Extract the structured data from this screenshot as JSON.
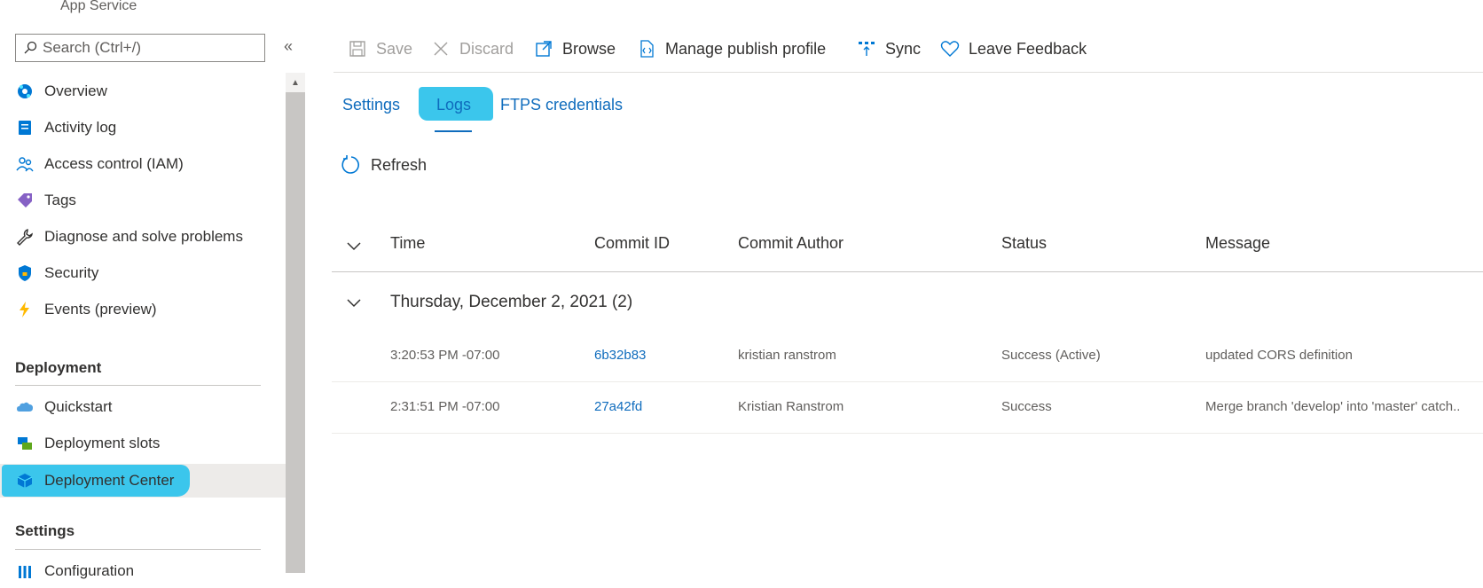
{
  "app": {
    "service_label": "App Service"
  },
  "search": {
    "placeholder": "Search (Ctrl+/)"
  },
  "collapse_icon": "double-chevron-left",
  "sidebar": {
    "items": [
      {
        "label": "Overview",
        "icon": "globe-icon"
      },
      {
        "label": "Activity log",
        "icon": "activity-log-icon"
      },
      {
        "label": "Access control (IAM)",
        "icon": "people-icon"
      },
      {
        "label": "Tags",
        "icon": "tag-icon"
      },
      {
        "label": "Diagnose and solve problems",
        "icon": "wrench-icon"
      },
      {
        "label": "Security",
        "icon": "shield-icon"
      },
      {
        "label": "Events (preview)",
        "icon": "lightning-icon"
      }
    ],
    "deployment_section": "Deployment",
    "deployment_items": [
      {
        "label": "Quickstart",
        "icon": "cloud-icon"
      },
      {
        "label": "Deployment slots",
        "icon": "slots-icon"
      },
      {
        "label": "Deployment Center",
        "icon": "cube-icon"
      }
    ],
    "settings_section": "Settings",
    "settings_items": [
      {
        "label": "Configuration",
        "icon": "bars-icon"
      }
    ]
  },
  "toolbar": {
    "save": "Save",
    "discard": "Discard",
    "browse": "Browse",
    "manage_publish_profile": "Manage publish profile",
    "sync": "Sync",
    "leave_feedback": "Leave Feedback"
  },
  "tabs": [
    {
      "label": "Settings"
    },
    {
      "label": "Logs",
      "selected": true
    },
    {
      "label": "FTPS credentials"
    }
  ],
  "refresh": "Refresh",
  "table": {
    "columns": [
      "Time",
      "Commit ID",
      "Commit Author",
      "Status",
      "Message"
    ],
    "group": "Thursday, December 2, 2021 (2)",
    "rows": [
      {
        "time": "3:20:53 PM -07:00",
        "commit_id": "6b32b83",
        "author": "kristian ranstrom",
        "status": "Success (Active)",
        "message": "updated CORS definition"
      },
      {
        "time": "2:31:51 PM -07:00",
        "commit_id": "27a42fd",
        "author": "Kristian Ranstrom",
        "status": "Success",
        "message": "Merge branch 'develop' into 'master' catch.."
      }
    ]
  },
  "colors": {
    "accent": "#0f6cbd",
    "highlight": "#3bc6ec",
    "active_bg": "#edebe9"
  }
}
